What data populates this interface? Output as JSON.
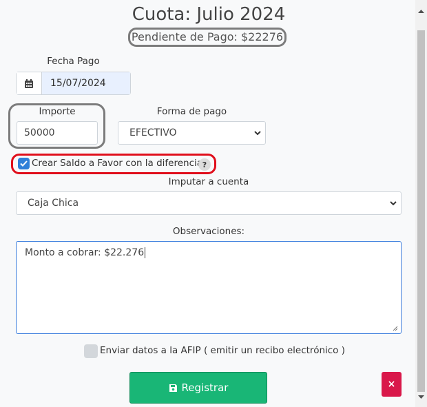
{
  "modal": {
    "title": "Cuota: Julio 2024",
    "pending_text": "Pendiente de Pago: $22276"
  },
  "fecha_pago": {
    "label": "Fecha Pago",
    "value": "15/07/2024"
  },
  "importe": {
    "label": "Importe",
    "value": "50000"
  },
  "forma_pago": {
    "label": "Forma de pago",
    "selected": "EFECTIVO"
  },
  "saldo_favor": {
    "label": "Crear Saldo a Favor con la diferencia",
    "checked": true,
    "help": "?"
  },
  "cuenta": {
    "label": "Imputar a cuenta",
    "selected": "Caja Chica"
  },
  "observaciones": {
    "label": "Observaciones:",
    "value": "Monto a cobrar: $22.276"
  },
  "afip": {
    "label": "Enviar datos a la AFIP ( emitir un recibo electrónico )",
    "checked": false
  },
  "actions": {
    "register_label": "Registrar",
    "close_label": "×"
  },
  "colors": {
    "accent_green": "#19b676",
    "danger": "#d9184a",
    "highlight_red": "#e00e1b",
    "checkbox_blue": "#2f7fd8"
  }
}
